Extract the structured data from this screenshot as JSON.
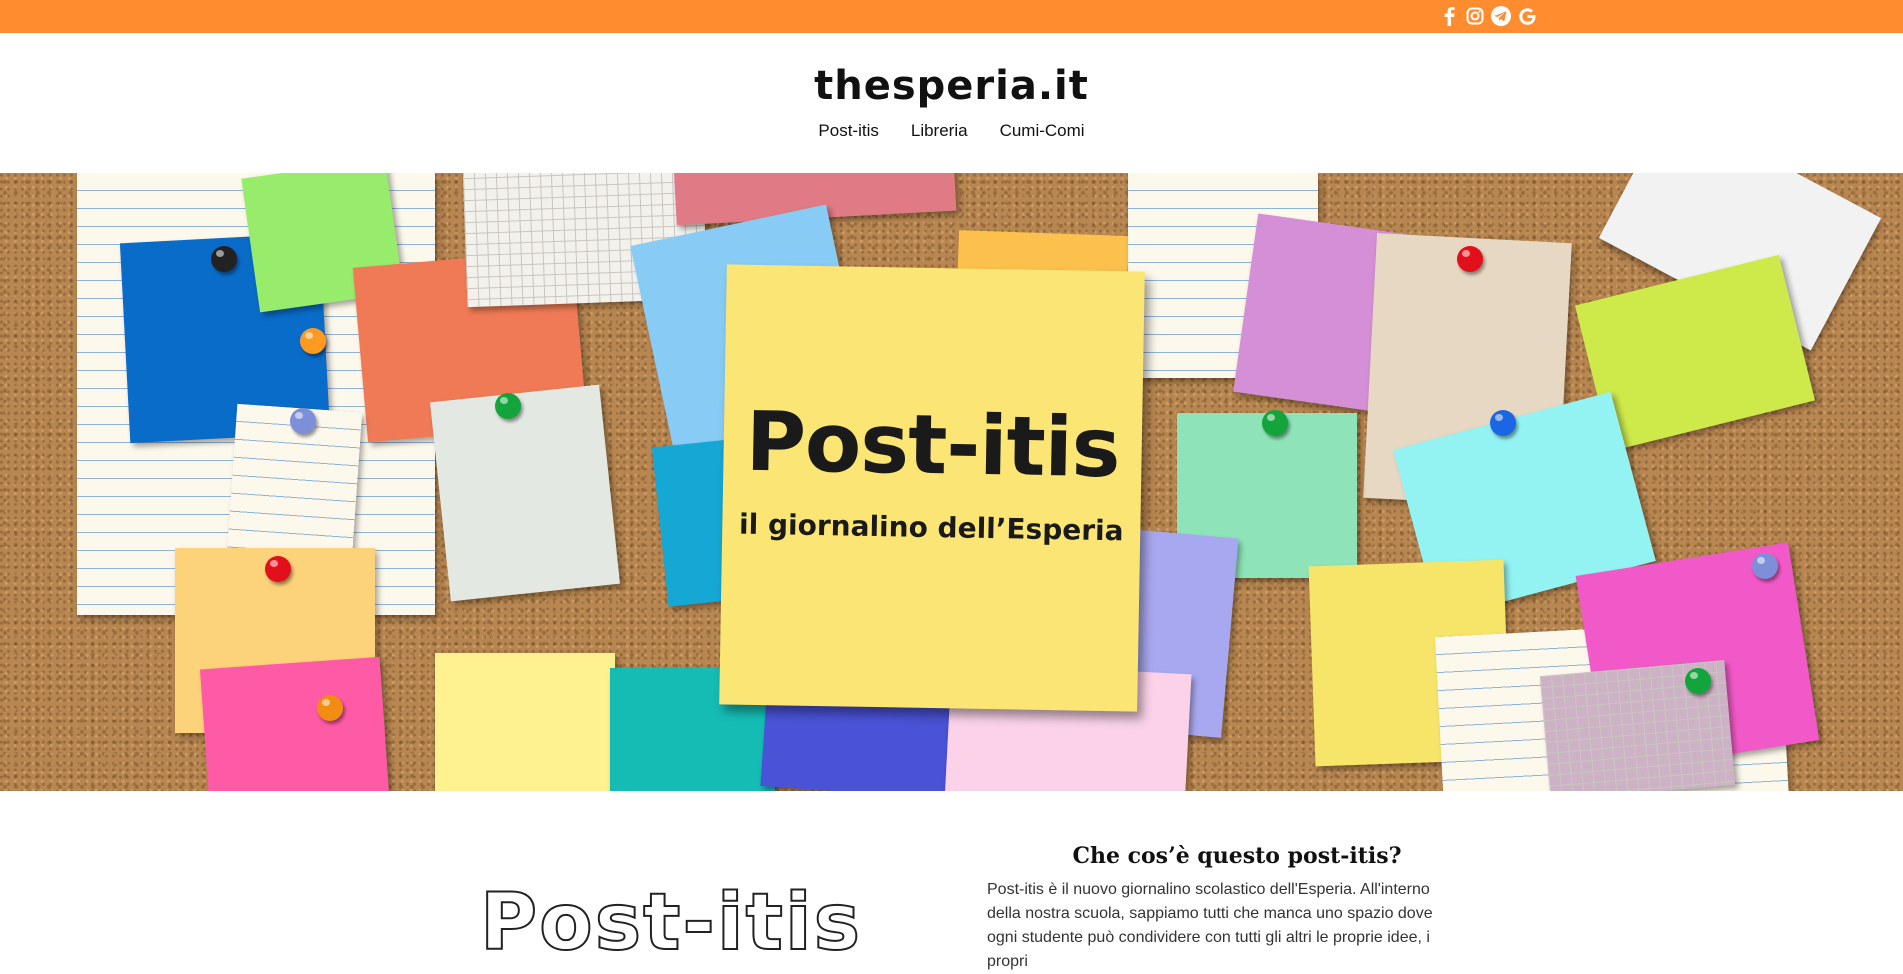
{
  "topbar": {
    "color": "#ff8c2f",
    "icons": [
      "facebook-icon",
      "instagram-icon",
      "telegram-icon",
      "google-icon"
    ]
  },
  "header": {
    "site_title": "thesperia.it"
  },
  "nav": {
    "items": [
      "Post-itis",
      "Libreria",
      "Cumi-Comi"
    ]
  },
  "hero": {
    "title": "Post-itis",
    "subtitle": "il giornalino dell’Esperia"
  },
  "about": {
    "logo_text": "Post-itis",
    "heading": "Che cos’è questo post-itis?",
    "text": "Post-itis è il nuovo giornalino scolastico dell'Esperia. All'interno della nostra scuola, sappiamo tutti che manca uno spazio dove ogni studente può condividere con tutti gli altri le proprie idee, i propri"
  }
}
